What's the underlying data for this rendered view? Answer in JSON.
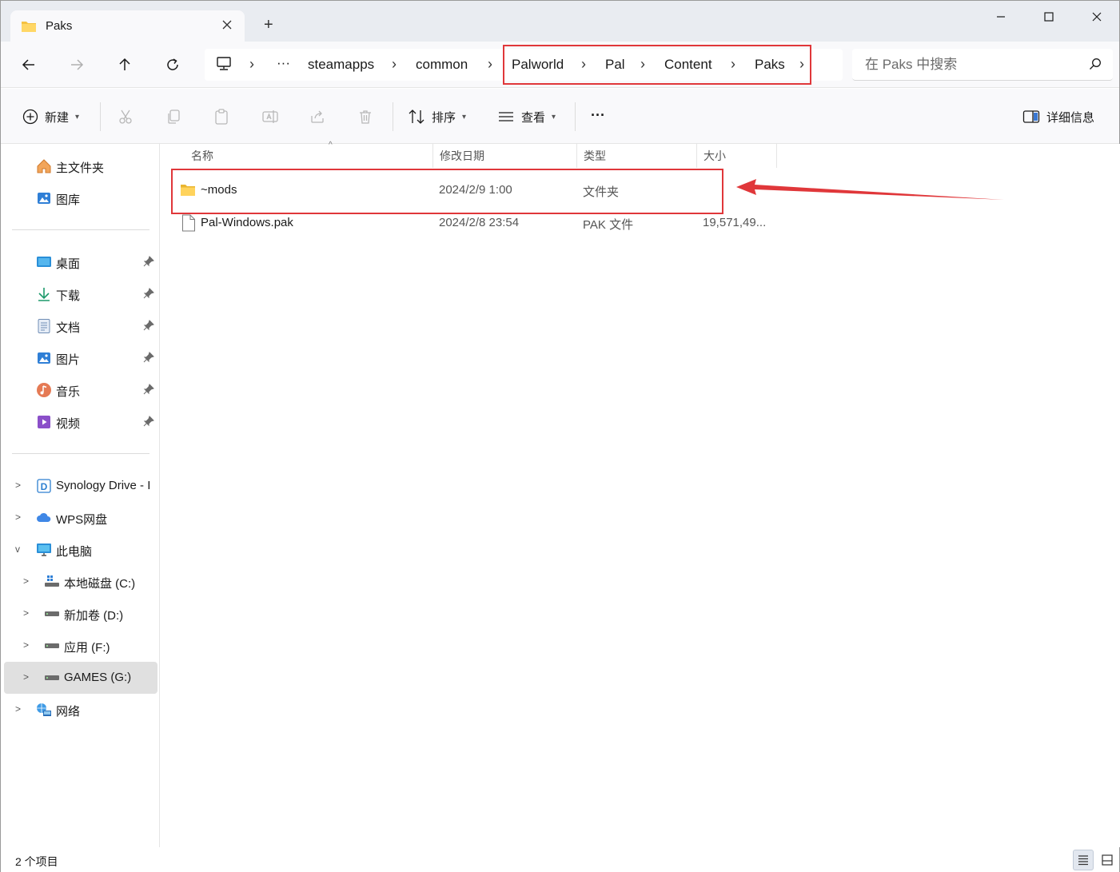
{
  "window": {
    "tab_title": "Paks",
    "tab_icon": "folder-icon",
    "new_tab": "+",
    "controls": [
      "minimize",
      "maximize",
      "close"
    ]
  },
  "nav": {
    "back_icon": "arrow-left-icon",
    "forward_icon": "arrow-right-icon",
    "up_icon": "arrow-up-icon",
    "refresh_icon": "refresh-icon"
  },
  "address": {
    "ellipsis": "···",
    "crumbs": [
      "steamapps",
      "common",
      "Palworld",
      "Pal",
      "Content",
      "Paks"
    ],
    "separator": "›",
    "highlight_color": "#e0373a"
  },
  "search": {
    "placeholder": "在 Paks 中搜索"
  },
  "toolbar": {
    "new_label": "新建",
    "sort_label": "排序",
    "view_label": "查看",
    "more_label": "···",
    "details_label": "详细信息",
    "disabled_actions": [
      "cut-icon",
      "copy-icon",
      "paste-icon",
      "rename-icon",
      "share-icon",
      "delete-icon"
    ]
  },
  "sidebar": {
    "quick": [
      {
        "label": "主文件夹",
        "icon": "home-icon"
      },
      {
        "label": "图库",
        "icon": "gallery-icon"
      }
    ],
    "pinned": [
      {
        "label": "桌面",
        "icon": "desktop-icon"
      },
      {
        "label": "下载",
        "icon": "download-icon"
      },
      {
        "label": "文档",
        "icon": "documents-icon"
      },
      {
        "label": "图片",
        "icon": "pictures-icon"
      },
      {
        "label": "音乐",
        "icon": "music-icon"
      },
      {
        "label": "视频",
        "icon": "videos-icon"
      }
    ],
    "tree": [
      {
        "label": "Synology Drive - I",
        "icon": "synology-drive-icon",
        "expanded": false
      },
      {
        "label": "WPS网盘",
        "icon": "cloud-icon",
        "expanded": false
      },
      {
        "label": "此电脑",
        "icon": "this-pc-icon",
        "expanded": true
      },
      {
        "label": "本地磁盘 (C:)",
        "icon": "windows-drive-icon",
        "expanded": false
      },
      {
        "label": "新加卷 (D:)",
        "icon": "drive-icon",
        "expanded": false
      },
      {
        "label": "应用 (F:)",
        "icon": "drive-icon",
        "expanded": false
      },
      {
        "label": "GAMES (G:)",
        "icon": "drive-icon",
        "expanded": false,
        "selected": true
      },
      {
        "label": "网络",
        "icon": "network-icon",
        "expanded": false
      }
    ]
  },
  "columns": [
    "名称",
    "修改日期",
    "类型",
    "大小"
  ],
  "files": [
    {
      "name": "~mods",
      "modified": "2024/2/9 1:00",
      "type": "文件夹",
      "size": "",
      "icon": "folder-icon"
    },
    {
      "name": "Pal-Windows.pak",
      "modified": "2024/2/8 23:54",
      "type": "PAK 文件",
      "size": "19,571,49...",
      "icon": "file-icon"
    }
  ],
  "status": {
    "item_count": "2 个项目"
  },
  "colors": {
    "annotation": "#e0373a",
    "folder": "#f5c242",
    "selected_bg": "#e0e0e0"
  }
}
